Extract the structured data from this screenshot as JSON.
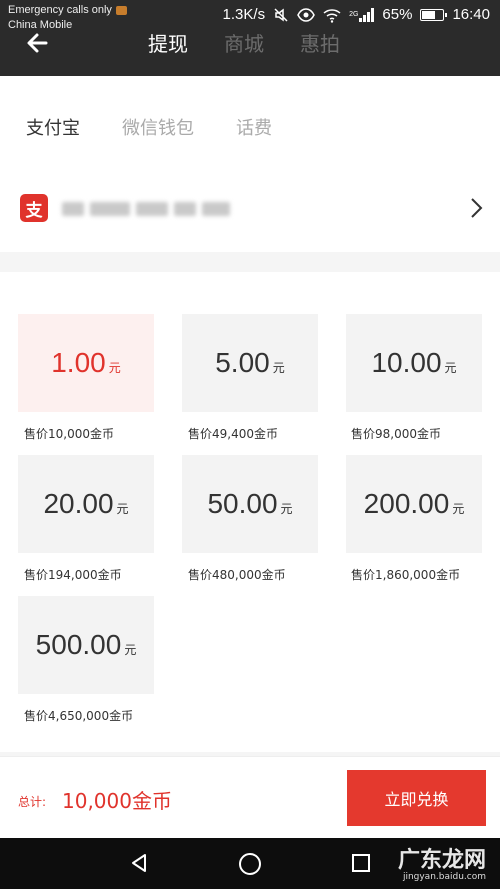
{
  "status_bar": {
    "carrier_line1": "Emergency calls only",
    "carrier_line2": "China Mobile",
    "speed": "1.3K/s",
    "network": "2G",
    "battery": "65%",
    "battery_level": 0.65,
    "time": "16:40"
  },
  "header": {
    "tabs": [
      {
        "label": "提现",
        "active": true
      },
      {
        "label": "商城",
        "active": false
      },
      {
        "label": "惠拍",
        "active": false
      }
    ]
  },
  "payment": {
    "tabs": [
      {
        "label": "支付宝",
        "active": true
      },
      {
        "label": "微信钱包",
        "active": false
      },
      {
        "label": "话费",
        "active": false
      }
    ],
    "alipay_glyph": "支"
  },
  "options": [
    {
      "amount": "1.00",
      "unit": "元",
      "price": "售价10,000金币",
      "selected": true
    },
    {
      "amount": "5.00",
      "unit": "元",
      "price": "售价49,400金币",
      "selected": false
    },
    {
      "amount": "10.00",
      "unit": "元",
      "price": "售价98,000金币",
      "selected": false
    },
    {
      "amount": "20.00",
      "unit": "元",
      "price": "售价194,000金币",
      "selected": false
    },
    {
      "amount": "50.00",
      "unit": "元",
      "price": "售价480,000金币",
      "selected": false
    },
    {
      "amount": "200.00",
      "unit": "元",
      "price": "售价1,860,000金币",
      "selected": false
    },
    {
      "amount": "500.00",
      "unit": "元",
      "price": "售价4,650,000金币",
      "selected": false
    }
  ],
  "footer": {
    "total_label": "总计:",
    "total_value": "10,000金币",
    "button_label": "立即兑换"
  },
  "watermark": {
    "text": "广东龙网",
    "sub": "jingyan.baidu.com"
  },
  "colors": {
    "accent": "#e0332c",
    "header_bg": "#2b2b2b",
    "selected_card_bg": "#fdf0ef"
  }
}
